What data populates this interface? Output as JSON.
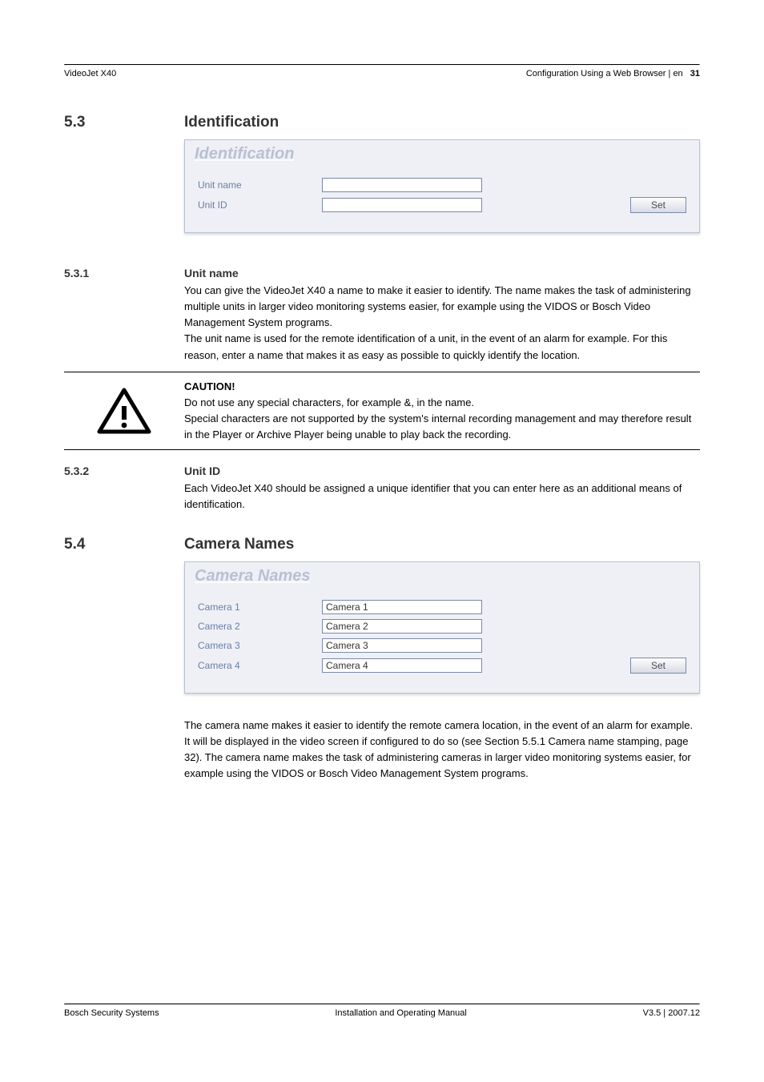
{
  "header": {
    "left": "VideoJet X40",
    "right_text": "Configuration Using a Web Browser | en",
    "page_number": "31"
  },
  "sections": {
    "s53": {
      "num": "5.3",
      "title": "Identification",
      "panel_title": "Identification",
      "rows": [
        {
          "label": "Unit name",
          "value": ""
        },
        {
          "label": "Unit ID",
          "value": ""
        }
      ],
      "button": "Set"
    },
    "s531": {
      "num": "5.3.1",
      "title": "Unit name",
      "para1": "You can give the VideoJet X40 a name to make it easier to identify. The name makes the task of administering multiple units in larger video monitoring systems easier, for example using the VIDOS or Bosch Video Management System programs.",
      "para2": "The unit name is used for the remote identification of a unit, in the event of an alarm for example. For this reason, enter a name that makes it as easy as possible to quickly identify the location."
    },
    "caution": {
      "title": "CAUTION!",
      "line1_a": "Do not use any special characters, for example ",
      "line1_b": "&",
      "line1_c": ", in the name.",
      "line2": "Special characters are not supported by the system's internal recording management and may therefore result in the Player or Archive Player being unable to play back the recording."
    },
    "s532": {
      "num": "5.3.2",
      "title": "Unit ID",
      "para": "Each VideoJet X40 should be assigned a unique identifier that you can enter here as an additional means of identification."
    },
    "s54": {
      "num": "5.4",
      "title": "Camera Names",
      "panel_title": "Camera Names",
      "rows": [
        {
          "label": "Camera 1",
          "value": "Camera 1"
        },
        {
          "label": "Camera 2",
          "value": "Camera 2"
        },
        {
          "label": "Camera 3",
          "value": "Camera 3"
        },
        {
          "label": "Camera 4",
          "value": "Camera 4"
        }
      ],
      "button": "Set",
      "para_a": "The camera name makes it easier to identify the remote camera location, in the event of an alarm for example. It will be displayed in the video screen if configured to do so (see ",
      "para_ref": "Section 5.5.1 Camera name stamping",
      "para_b": ", page 32). The camera name makes the task of administering cameras in larger video monitoring systems easier, for example using the VIDOS or Bosch Video Management System programs."
    }
  },
  "footer": {
    "left": "Bosch Security Systems",
    "center": "Installation and Operating Manual",
    "right": "V3.5 | 2007.12"
  }
}
